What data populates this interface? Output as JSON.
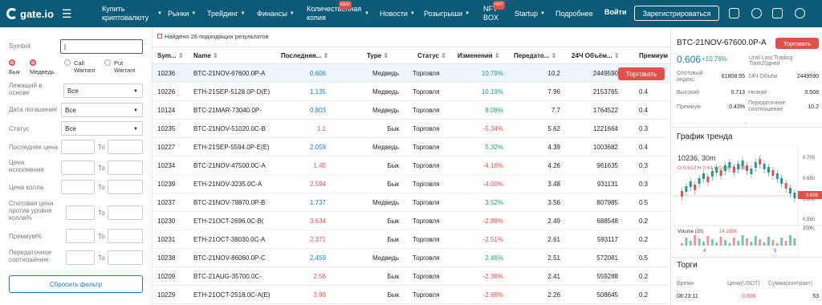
{
  "header": {
    "logo": "gate.io",
    "nav": [
      {
        "label": "Купить криптовалюту",
        "caret": true
      },
      {
        "label": "Рынки",
        "caret": true
      },
      {
        "label": "Трейдинг",
        "caret": true
      },
      {
        "label": "Финансы",
        "caret": true
      },
      {
        "label": "Количественная копия",
        "caret": true,
        "badge": "NEW"
      },
      {
        "label": "Новости",
        "caret": true
      },
      {
        "label": "Розыгрыши",
        "caret": true
      },
      {
        "label": "NFT BOX",
        "caret": false,
        "badge": "HOT"
      },
      {
        "label": "Startup",
        "caret": true
      },
      {
        "label": "Подробнее",
        "caret": true
      }
    ],
    "login": "Войти",
    "register": "Зарегистрироваться"
  },
  "filter": {
    "symbol_label": "Symbol",
    "bull": "Бык",
    "bear": "Медведь",
    "call": "Call Warrant",
    "put": "Put Warrant",
    "underlying_label": "Лежащий в основе",
    "underlying_value": "Все",
    "expiry_label": "Дата погашения",
    "expiry_value": "Все",
    "status_label": "Статус",
    "status_value": "Все",
    "last_price_label": "Последняя цена",
    "strike_label": "Цена исполнения",
    "call_price_label": "Цена колла",
    "spot_label": "Спотовая цена против уровня колла%",
    "premium_label": "Премиум%",
    "leverage_label": "Передаточное соотношение",
    "to": "То",
    "reset": "Сбросить фильтр"
  },
  "table": {
    "found": "Найдено 26 подходящих результатов",
    "headers": [
      "Sym...",
      "Name",
      "Последняя...",
      "Type",
      "Статус",
      "Изменения",
      "Передато...",
      "24Ч Объём...",
      "Премиум"
    ],
    "trade_button": "Торговать",
    "rows": [
      [
        "10236",
        "BTC-21NOV-67600.0P-A",
        "0.606",
        "Медведь",
        "Торговля",
        "10.79%",
        "10.2",
        "2449590",
        "0"
      ],
      [
        "10226",
        "ETH-21SEP-5128.0P-D(E)",
        "1.135",
        "Медведь",
        "Торговля",
        "10.19%",
        "7.96",
        "2153765",
        "0.4"
      ],
      [
        "10124",
        "BTC-21MAR-73040.0P-",
        "0.803",
        "Медведь",
        "Торговля",
        "8.08%",
        "7.7",
        "1764522",
        "0.4"
      ],
      [
        "10235",
        "BTC-21NOV-51020.0C-B",
        "1.1",
        "Бык",
        "Торговля",
        "-5.34%",
        "5.62",
        "1221664",
        "0.3"
      ],
      [
        "10227",
        "ETH-21SEP-5594.0P-E(E)",
        "2.059",
        "Медведь",
        "Торговля",
        "5.32%",
        "4.39",
        "1003682",
        "0.4"
      ],
      [
        "10234",
        "BTC-21NOV-47500.0C-A",
        "1.45",
        "Бык",
        "Торговля",
        "-4.16%",
        "4.26",
        "961635",
        "0.3"
      ],
      [
        "10239",
        "ETH-21NOV-3235.0C-A",
        "2.594",
        "Бык",
        "Торговля",
        "-4.00%",
        "3.48",
        "931131",
        "0.3"
      ],
      [
        "10237",
        "BTC-21NOV-78870.0P-B",
        "1.737",
        "Медведь",
        "Торговля",
        "3.52%",
        "3.56",
        "807985",
        "0.5"
      ],
      [
        "10230",
        "ETH-21OCT-2696.0C-B(",
        "3.634",
        "Бык",
        "Торговля",
        "-2.89%",
        "2.49",
        "688548",
        "0.2"
      ],
      [
        "10231",
        "ETH-21OCT-38030.0C-A",
        "2.371",
        "Бык",
        "Торговля",
        "-2.51%",
        "2.61",
        "593117",
        "0.2"
      ],
      [
        "10238",
        "BTC-21NOV-86060.0P-C",
        "2.459",
        "Медведь",
        "Торговля",
        "2.46%",
        "2.51",
        "572081",
        "0.5"
      ],
      [
        "10209",
        "BTC-21AUG-35700.0C-",
        "2.56",
        "Бык",
        "Торговля",
        "-2.36%",
        "2.41",
        "559288",
        "0.2"
      ],
      [
        "10229",
        "ETH-21OCT-2518.0C-A(E)",
        "3.99",
        "Бык",
        "Торговля",
        "-2.66%",
        "2.26",
        "508645",
        "0.2"
      ]
    ]
  },
  "side": {
    "title": "BTC-21NOV-67600.0P-A",
    "trade": "Торговать",
    "price": "0.606",
    "change": "+10.79%",
    "until": "Until Last Trading Time20дней",
    "stats": [
      {
        "k": "Спотовый индекс",
        "v": "61808.55"
      },
      {
        "k": "24Ч Объём",
        "v": "2449590"
      },
      {
        "k": "Высокий",
        "v": "0.713"
      },
      {
        "k": "Низкий",
        "v": "0.508"
      },
      {
        "k": "Премиум",
        "v": "0.43%"
      },
      {
        "k": "Передаточное соотношение",
        "v": "10.2"
      }
    ],
    "trend_title": "График тренда",
    "chart_symbol": "10236, 30m",
    "ohlc": "O 0.613  H 0.61  L 0.6  C 0.606",
    "y_ticks": [
      "0.700",
      "0.650",
      "0.600",
      "0.550"
    ],
    "current": "0.606",
    "volume_label": "Volume (20)",
    "volume_value": "14.185K",
    "vol_tick": "200K",
    "x_ticks": [
      "4",
      "5"
    ],
    "trades_title": "Торги",
    "trades_cols": [
      "Время",
      "Цена(USDT)",
      "Сумма(контракт)"
    ],
    "trades_rows": [
      [
        "08:23:11",
        "0.606",
        "53"
      ]
    ]
  }
}
